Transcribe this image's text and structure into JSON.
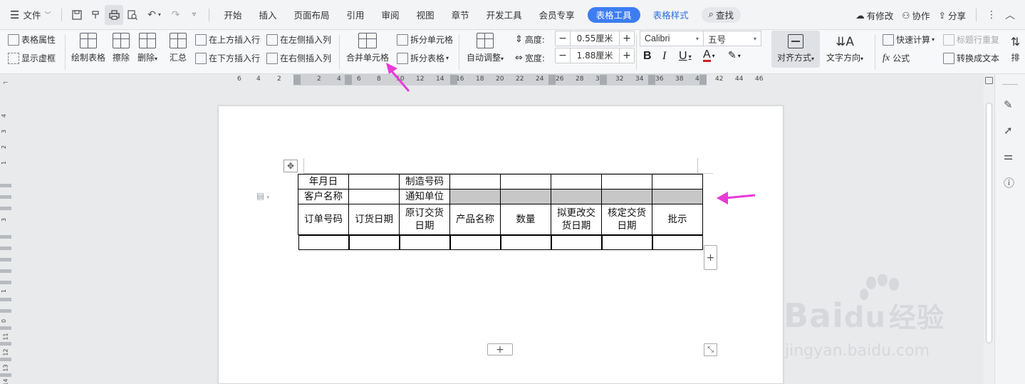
{
  "menubar": {
    "file_label": "文件",
    "tabs": [
      "开始",
      "插入",
      "页面布局",
      "引用",
      "审阅",
      "视图",
      "章节",
      "开发工具",
      "会员专享"
    ],
    "active_tab": "表格工具",
    "secondary_tab": "表格样式",
    "search_label": "查找",
    "status_label": "有修改",
    "collab_label": "协作",
    "share_label": "分享"
  },
  "ribbon": {
    "table_props": "表格属性",
    "show_grid": "显示虚框",
    "draw_table": "绘制表格",
    "erase": "擦除",
    "delete": "删除",
    "summary": "汇总",
    "insert_above": "在上方插入行",
    "insert_below": "在下方插入行",
    "insert_left": "在左侧插入列",
    "insert_right": "在右侧插入列",
    "merge_cells": "合并单元格",
    "split_cells": "拆分单元格",
    "split_table": "拆分表格",
    "auto_fit": "自动调整",
    "height_label": "高度:",
    "height_value": "0.55厘米",
    "width_label": "宽度:",
    "width_value": "1.88厘米",
    "font_name": "Calibri",
    "font_size": "五号",
    "align": "对齐方式",
    "text_direction": "文字方向",
    "quick_calc": "快速计算",
    "formula": "公式",
    "title_repeat": "标题行重复",
    "convert_text": "转换成文本",
    "sort": "排"
  },
  "ruler": {
    "labels": [
      "6",
      "4",
      "2",
      "2",
      "4",
      "6",
      "8",
      "10",
      "12",
      "14",
      "16",
      "18",
      "20",
      "22",
      "24",
      "26",
      "28",
      "30",
      "32",
      "34",
      "36",
      "38",
      "40",
      "42",
      "44",
      "46"
    ]
  },
  "vruler": {
    "labels": [
      "4",
      "3",
      "2",
      "1",
      "3",
      "1",
      "0",
      "11",
      "12",
      "13",
      "14"
    ]
  },
  "table": {
    "rows": [
      [
        "年月日",
        "",
        "制造号码",
        "",
        "",
        "",
        "",
        ""
      ],
      [
        "客户名称",
        "",
        "通知单位",
        "",
        "",
        "",
        "",
        ""
      ],
      [
        "订单号码",
        "订货日期",
        "原订交货日期",
        "产品名称",
        "数量",
        "拟更改交货日期",
        "核定交货日期",
        "批示"
      ],
      [
        "",
        "",
        "",
        "",
        "",
        "",
        "",
        ""
      ],
      [
        "",
        "",
        "",
        "",
        "",
        "",
        "",
        ""
      ],
      [
        "",
        "",
        "",
        "",
        "",
        "",
        "",
        ""
      ],
      [
        "",
        "",
        "",
        "",
        "",
        "",
        "",
        ""
      ],
      [
        "",
        "",
        "",
        "",
        "",
        "",
        "",
        ""
      ],
      [
        "",
        "",
        "",
        "",
        "",
        "",
        "",
        ""
      ],
      [
        "",
        "",
        "",
        "",
        "",
        "",
        "",
        ""
      ]
    ],
    "header_lines": {
      "c2": [
        "原订交货",
        "日期"
      ],
      "c5": [
        "拟更改交",
        "货日期"
      ],
      "c6": [
        "核定交货",
        "日期"
      ]
    }
  },
  "colors": {
    "accent": "#3d7df2",
    "arrow": "#e83ad8",
    "selection": "#c7c7c7"
  },
  "watermark": {
    "logo_a": "Bai",
    "logo_b": "du",
    "logo_c": "经验",
    "url": "jingyan.baidu.com"
  }
}
